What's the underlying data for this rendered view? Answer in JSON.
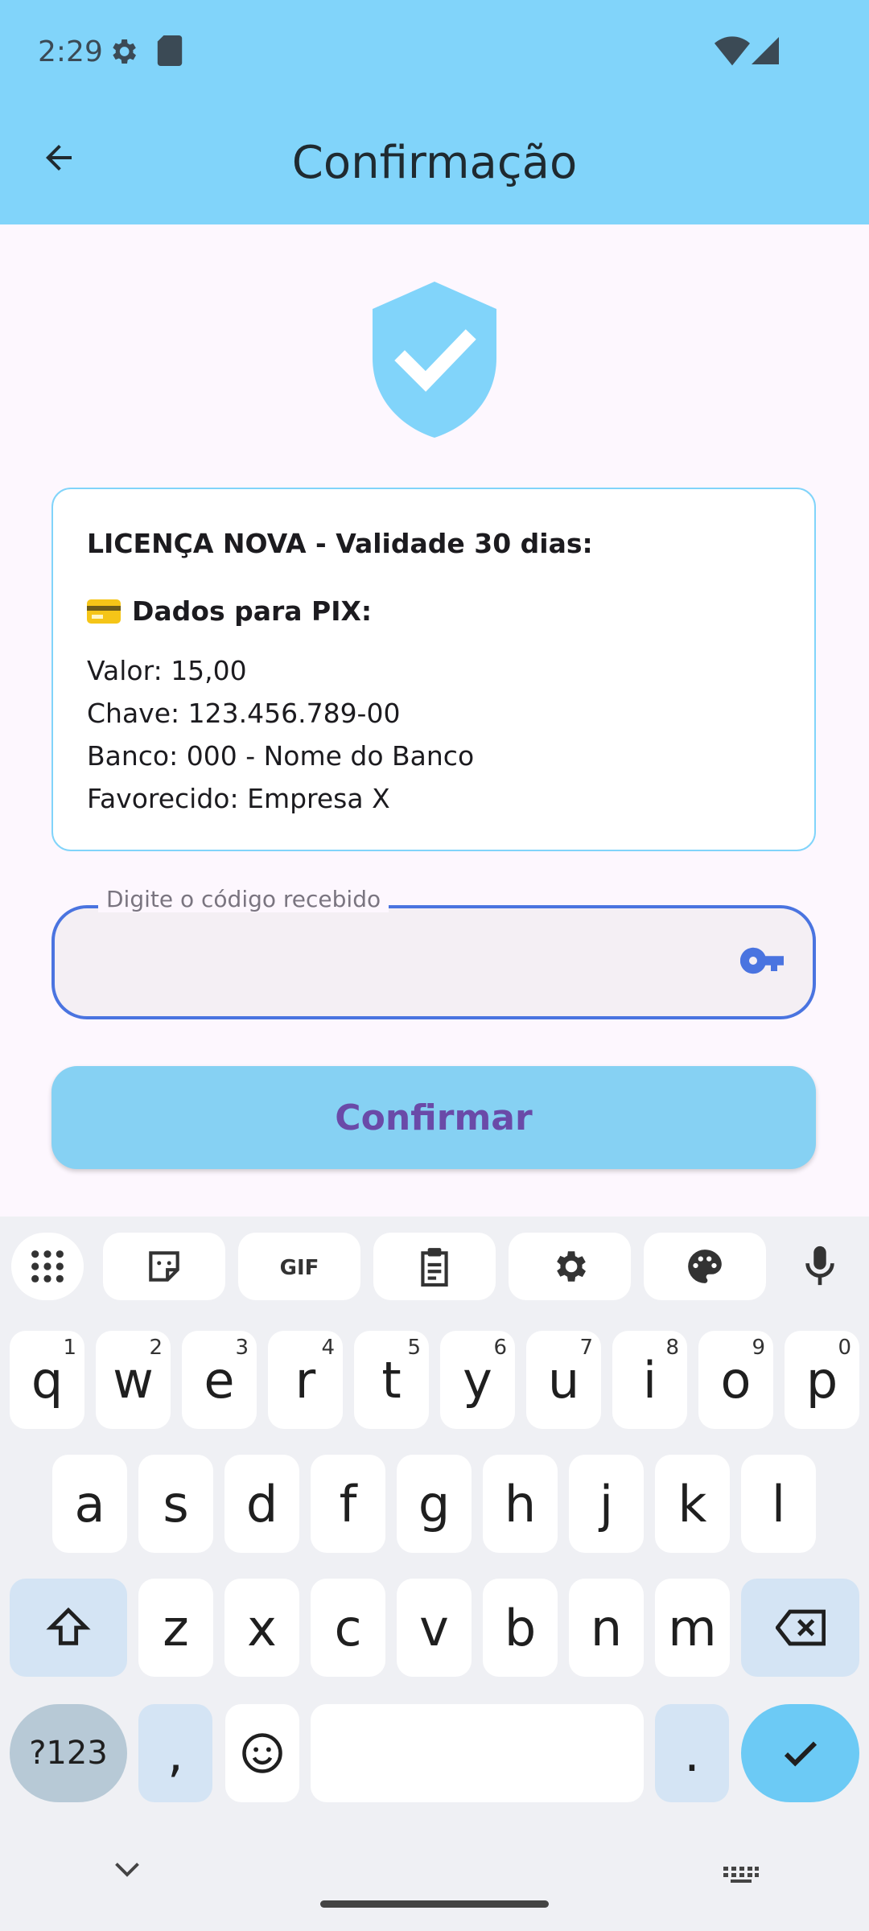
{
  "status_bar": {
    "time": "2:29"
  },
  "app_bar": {
    "title": "Confirmação"
  },
  "card": {
    "title": "LICENÇA NOVA - Validade 30 dias:",
    "pix_heading": "Dados para PIX:",
    "lines": [
      "Valor: 15,00",
      "Chave: 123.456.789-00",
      "Banco: 000 - Nome do Banco",
      "Favorecido: Empresa X"
    ]
  },
  "code_field": {
    "label": "Digite o código recebido",
    "value": ""
  },
  "confirm_button": {
    "label": "Confirmar"
  },
  "keyboard": {
    "row1": [
      {
        "char": "q",
        "hint": "1"
      },
      {
        "char": "w",
        "hint": "2"
      },
      {
        "char": "e",
        "hint": "3"
      },
      {
        "char": "r",
        "hint": "4"
      },
      {
        "char": "t",
        "hint": "5"
      },
      {
        "char": "y",
        "hint": "6"
      },
      {
        "char": "u",
        "hint": "7"
      },
      {
        "char": "i",
        "hint": "8"
      },
      {
        "char": "o",
        "hint": "9"
      },
      {
        "char": "p",
        "hint": "0"
      }
    ],
    "row2": [
      "a",
      "s",
      "d",
      "f",
      "g",
      "h",
      "j",
      "k",
      "l"
    ],
    "row3": [
      "z",
      "x",
      "c",
      "v",
      "b",
      "n",
      "m"
    ],
    "symbols_label": "?123",
    "comma": ",",
    "period": "."
  },
  "colors": {
    "accent": "#81d4fa",
    "button_text": "#6a4aa8",
    "field_border": "#4a74e0"
  }
}
